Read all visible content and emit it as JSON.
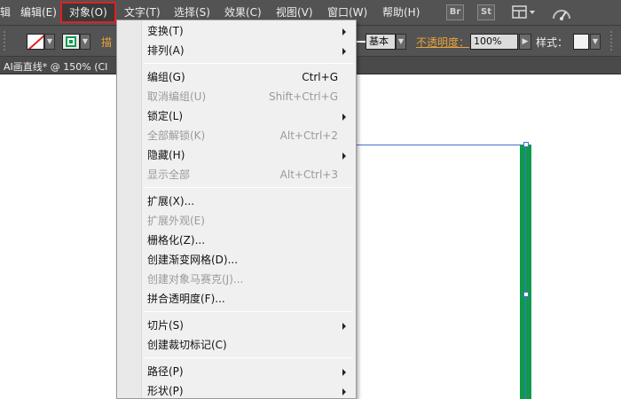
{
  "menubar": {
    "items": [
      {
        "label": "辑"
      },
      {
        "label": "编辑(E)"
      },
      {
        "label": "对象(O)"
      },
      {
        "label": "文字(T)"
      },
      {
        "label": "选择(S)"
      },
      {
        "label": "效果(C)"
      },
      {
        "label": "视图(V)"
      },
      {
        "label": "窗口(W)"
      },
      {
        "label": "帮助(H)"
      }
    ],
    "icons": {
      "br": "Br",
      "st": "St"
    }
  },
  "controlbar": {
    "stroke_label": "描",
    "basic_label": "基本",
    "opacity_label": "不透明度：",
    "opacity_value": "100%",
    "style_label": "样式："
  },
  "document": {
    "tab_title": "AI画直线* @ 150% (CI"
  },
  "object_menu": {
    "items": [
      {
        "label": "变换(T)",
        "submenu": true
      },
      {
        "label": "排列(A)",
        "submenu": true
      },
      {
        "label": "编组(G)",
        "shortcut": "Ctrl+G"
      },
      {
        "label": "取消编组(U)",
        "shortcut": "Shift+Ctrl+G",
        "disabled": true
      },
      {
        "label": "锁定(L)",
        "submenu": true
      },
      {
        "label": "全部解锁(K)",
        "shortcut": "Alt+Ctrl+2",
        "disabled": true
      },
      {
        "label": "隐藏(H)",
        "submenu": true
      },
      {
        "label": "显示全部",
        "shortcut": "Alt+Ctrl+3",
        "disabled": true
      },
      {
        "label": "扩展(X)..."
      },
      {
        "label": "扩展外观(E)",
        "disabled": true
      },
      {
        "label": "栅格化(Z)..."
      },
      {
        "label": "创建渐变网格(D)..."
      },
      {
        "label": "创建对象马赛克(J)...",
        "disabled": true
      },
      {
        "label": "拼合透明度(F)..."
      },
      {
        "label": "切片(S)",
        "submenu": true
      },
      {
        "label": "创建裁切标记(C)"
      },
      {
        "label": "路径(P)",
        "submenu": true
      },
      {
        "label": "形状(P)",
        "submenu": true
      }
    ]
  },
  "colors": {
    "ui_dark": "#535353",
    "menu_bg": "#f0f0f0",
    "highlight_border": "#e02020",
    "stroke_orange": "#e8a33a",
    "green_shape": "#0e9a4b",
    "selection_blue": "#4a6fd8"
  }
}
